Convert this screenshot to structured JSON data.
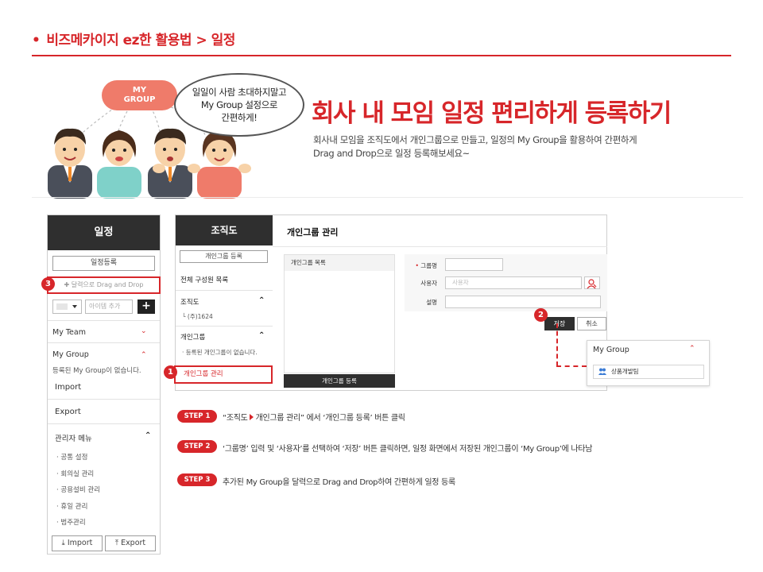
{
  "header": {
    "bullet": "•",
    "title": "비즈메카이지 ez한 활용법 > 일정"
  },
  "hero": {
    "mygroup_bubble_line1": "MY",
    "mygroup_bubble_line2": "GROUP",
    "speech_line1": "일일이 사람 초대하지말고",
    "speech_line2": "My Group 설정으로",
    "speech_line3": "간편하게!",
    "headline": "회사 내 모임 일정 편리하게 등록하기",
    "desc_line1": "회사내 모임을 조직도에서 개인그룹으로 만들고, 일정의 My Group을 활용하여 간편하게",
    "desc_line2": "Drag and Drop으로 일정 등록해보세요~"
  },
  "left_panel": {
    "title": "일정",
    "register_button": "일정등록",
    "drag_drop": "✚ 달력으로 Drag and Drop",
    "item_placeholder": "아이템 추가",
    "plus": "+",
    "my_team": "My Team",
    "my_group": "My Group",
    "my_group_empty": "등록된 My Group이 없습니다.",
    "import": "Import",
    "export": "Export",
    "admin_menu": "관리자 메뉴",
    "admin_items": [
      "· 공통 설정",
      "· 회의실 관리",
      "· 공용설비 관리",
      "· 휴일 관리",
      "· 범주관리"
    ],
    "bottom_import": "Import",
    "bottom_export": "Export",
    "chev_down": "⌄",
    "chev_up": "⌃",
    "upload_glyph": "⤓",
    "export_glyph": "⤒"
  },
  "org_panel": {
    "title": "조직도",
    "group_button": "개인그룹 등록",
    "all_members": "전체 구성원 목록",
    "org": "조직도",
    "org_company": "└ (주)1624",
    "personal_group": "개인그룹",
    "personal_group_empty": "· 등록된 개인그룹이 없습니다.",
    "manage": "개인그룹 관리"
  },
  "group_mgmt": {
    "title": "개인그룹 관리",
    "list_header": "개인그룹 목록",
    "register_button": "개인그룹 등록",
    "label_name_req": "•",
    "label_name": " 그룹명",
    "label_user": "사용자",
    "label_desc": "설명",
    "user_placeholder": "사용자",
    "save": "저장",
    "cancel": "취소"
  },
  "callout": {
    "title": "My Group",
    "item": "상품개발팀"
  },
  "badges": [
    "1",
    "2",
    "3"
  ],
  "steps": [
    {
      "label": "STEP 1",
      "text_a": "“조직도",
      "text_b": "개인그룹 관리” 에서 ‘개인그룹 등록’ 버튼 클릭"
    },
    {
      "label": "STEP 2",
      "text": "‘그룹명’ 입력 및 ‘사용자’를 선택하여 ‘저장’ 버튼 클릭하면, 일정 화면에서 저장된 개인그룹이 ‘My Group’에 나타남"
    },
    {
      "label": "STEP 3",
      "text": "추가된 My Group을 달력으로 Drag and Drop하여 간편하게 일정 등록"
    }
  ],
  "colors": {
    "accent": "#d7262a",
    "dark_header": "#2f2f2f",
    "bubble": "#ef7b6a"
  }
}
